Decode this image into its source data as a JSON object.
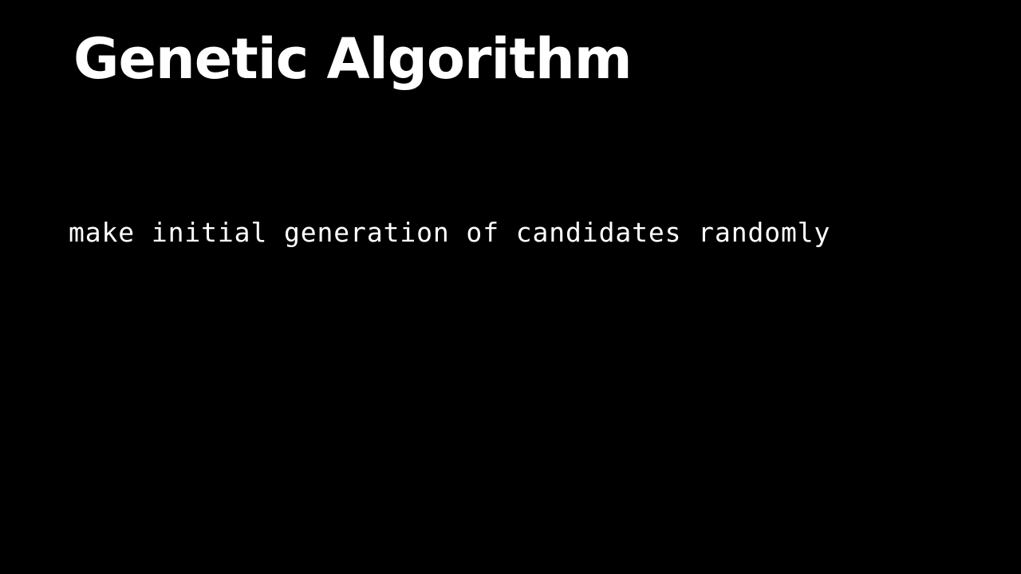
{
  "slide": {
    "title": "Genetic Algorithm",
    "lines": [
      "make initial generation of candidates randomly"
    ]
  },
  "colors": {
    "background": "#000000",
    "text": "#ffffff"
  }
}
